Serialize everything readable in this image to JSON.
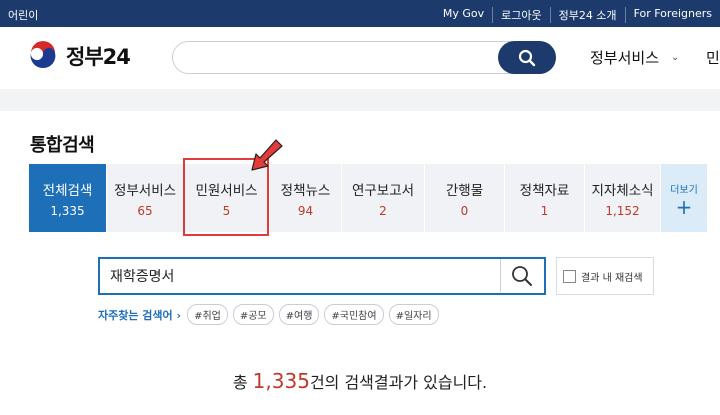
{
  "topbar": {
    "kids": "어린이",
    "links": [
      "My Gov",
      "로그아웃",
      "정부24 소개",
      "For Foreigners"
    ]
  },
  "header": {
    "logo_text": "정부24",
    "search_value": "",
    "nav_item": "정부서비스",
    "nav_item2": "민"
  },
  "page": {
    "title": "통합검색"
  },
  "tabs": [
    {
      "label": "전체검색",
      "count": "1,335",
      "active": true
    },
    {
      "label": "정부서비스",
      "count": "65"
    },
    {
      "label": "민원서비스",
      "count": "5"
    },
    {
      "label": "정책뉴스",
      "count": "94"
    },
    {
      "label": "연구보고서",
      "count": "2"
    },
    {
      "label": "간행물",
      "count": "0"
    },
    {
      "label": "정책자료",
      "count": "1"
    },
    {
      "label": "지자체소식",
      "count": "1,152"
    }
  ],
  "more": {
    "label": "더보기",
    "plus": "+"
  },
  "result_search": {
    "value": "재학증명서",
    "within_label": "결과 내 재검색"
  },
  "frequent": {
    "title": "자주찾는 검색어",
    "chevron": "›",
    "chips": [
      "#취업",
      "#공모",
      "#여행",
      "#국민참여",
      "#일자리"
    ]
  },
  "summary": {
    "prefix": "총 ",
    "count": "1,335",
    "suffix": "건의 검색결과가 있습니다."
  },
  "colors": {
    "navy": "#1c3a6b",
    "active_tab": "#1d6fb8",
    "count_red": "#c0392b",
    "highlight": "#e53a3a"
  }
}
